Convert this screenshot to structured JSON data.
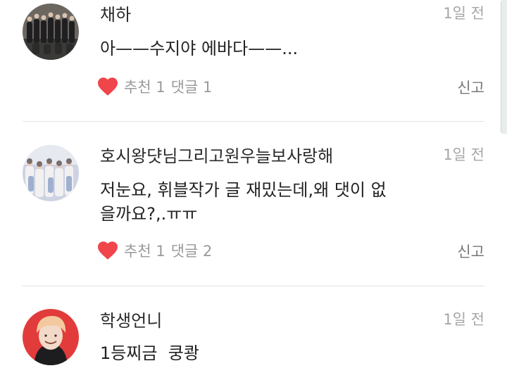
{
  "comments": [
    {
      "author": "채하",
      "time": "1일 전",
      "text": "아——수지야 에바다——...",
      "likes_label": "추천 1",
      "replies_label": "댓글 1",
      "report_label": "신고",
      "avatar_bg": "#5a5550"
    },
    {
      "author": "호시왕댯님그리고원우늘보사랑해",
      "time": "1일 전",
      "text": "저눈요, 휘블작가 글 재밌는데,왜 댓이 없을까요?,.ㅠㅠ",
      "likes_label": "추천 1",
      "replies_label": "댓글 2",
      "report_label": "신고",
      "avatar_bg": "#c9cfe0"
    },
    {
      "author": "학생언니",
      "time": "1일 전",
      "text": "1등찌금  쿵쾅",
      "avatar_bg": "#e23b3b"
    }
  ],
  "colors": {
    "heart": "#f0454a",
    "muted_text": "#9a9a9a",
    "divider": "#e2e2e2"
  },
  "icons": {
    "like": "heart-icon"
  }
}
